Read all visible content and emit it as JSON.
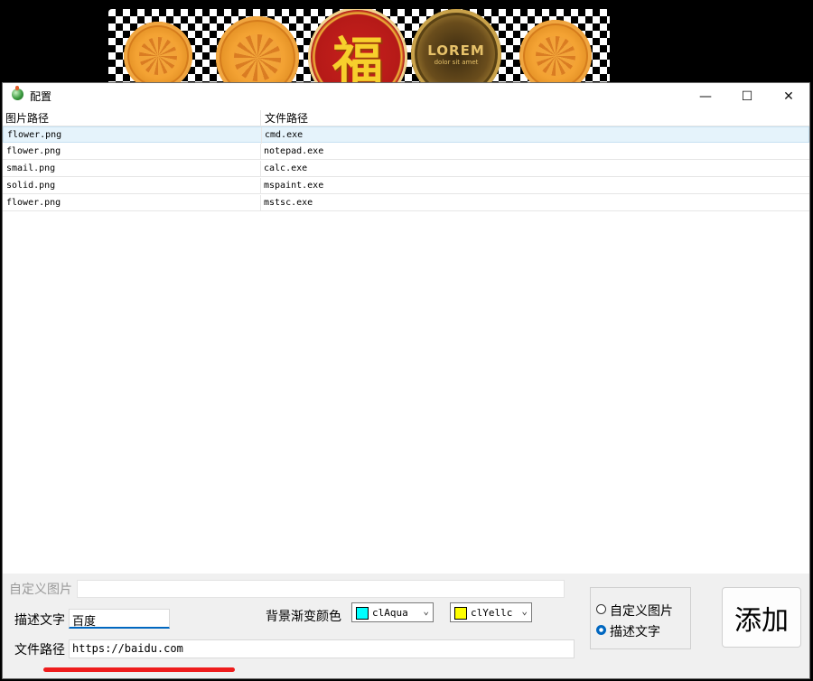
{
  "dock": {
    "coins": [
      {
        "name": "flower-coin-1"
      },
      {
        "name": "flower-coin-2"
      },
      {
        "name": "fu-coin",
        "text": "福"
      },
      {
        "name": "lorem-coin",
        "text": "LOREM",
        "subtext": "dolor sit amet"
      },
      {
        "name": "flower-coin-3"
      }
    ]
  },
  "window": {
    "title": "配置",
    "controls": {
      "minimize": "—",
      "maximize": "☐",
      "close": "✕"
    }
  },
  "list": {
    "headers": [
      "图片路径",
      "文件路径"
    ],
    "rows": [
      {
        "image": "flower.png",
        "file": "cmd.exe"
      },
      {
        "image": "flower.png",
        "file": "notepad.exe"
      },
      {
        "image": "smail.png",
        "file": "calc.exe"
      },
      {
        "image": "solid.png",
        "file": "mspaint.exe"
      },
      {
        "image": "flower.png",
        "file": "mstsc.exe"
      }
    ],
    "selected_index": 0
  },
  "form": {
    "custom_image_label": "自定义图片",
    "custom_image_value": "",
    "desc_label": "描述文字",
    "desc_value": "百度",
    "path_label": "文件路径",
    "path_value": "https://baidu.com",
    "gradient_label": "背景渐变颜色",
    "color1": {
      "text": "clAqua",
      "hex": "#00ffff"
    },
    "color2": {
      "text": "clYellc",
      "hex": "#ffff00"
    },
    "radio_custom_image": "自定义图片",
    "radio_desc_text": "描述文字",
    "radio_selected": "desc_text",
    "add_button": "添加"
  },
  "colors": {
    "annotation_underline": "#ee1c1c",
    "accent": "#0067c0"
  }
}
